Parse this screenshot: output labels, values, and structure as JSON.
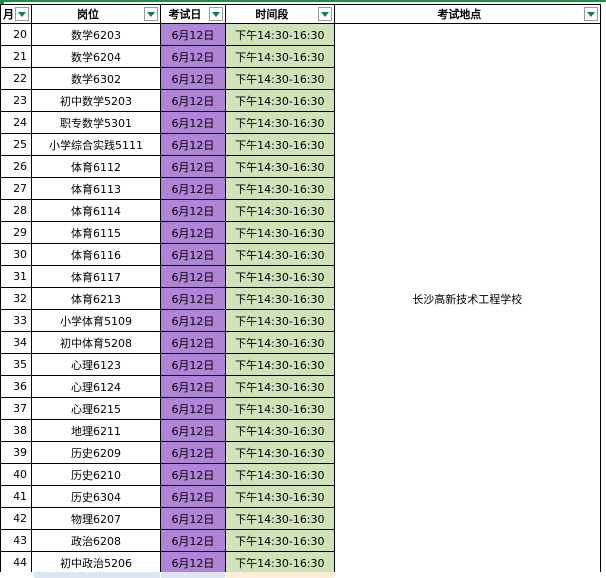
{
  "headers": {
    "no": "月",
    "position": "岗位",
    "date": "考试日",
    "time": "时间段",
    "location": "考试地点"
  },
  "location_merged": "长沙高新技术工程学校",
  "colors": {
    "date_fill": "#b084d6",
    "time_fill": "#cfe2b8",
    "dropdown_arrow": "#1a7f47",
    "selection_border": "#1f8c4a"
  },
  "rows": [
    {
      "no": "20",
      "position": "数学6203",
      "date": "6月12日",
      "time": "下午14:30-16:30"
    },
    {
      "no": "21",
      "position": "数学6204",
      "date": "6月12日",
      "time": "下午14:30-16:30"
    },
    {
      "no": "22",
      "position": "数学6302",
      "date": "6月12日",
      "time": "下午14:30-16:30"
    },
    {
      "no": "23",
      "position": "初中数学5203",
      "date": "6月12日",
      "time": "下午14:30-16:30"
    },
    {
      "no": "24",
      "position": "职专数学5301",
      "date": "6月12日",
      "time": "下午14:30-16:30"
    },
    {
      "no": "25",
      "position": "小学综合实践5111",
      "date": "6月12日",
      "time": "下午14:30-16:30"
    },
    {
      "no": "26",
      "position": "体育6112",
      "date": "6月12日",
      "time": "下午14:30-16:30"
    },
    {
      "no": "27",
      "position": "体育6113",
      "date": "6月12日",
      "time": "下午14:30-16:30"
    },
    {
      "no": "28",
      "position": "体育6114",
      "date": "6月12日",
      "time": "下午14:30-16:30"
    },
    {
      "no": "29",
      "position": "体育6115",
      "date": "6月12日",
      "time": "下午14:30-16:30"
    },
    {
      "no": "30",
      "position": "体育6116",
      "date": "6月12日",
      "time": "下午14:30-16:30"
    },
    {
      "no": "31",
      "position": "体育6117",
      "date": "6月12日",
      "time": "下午14:30-16:30"
    },
    {
      "no": "32",
      "position": "体育6213",
      "date": "6月12日",
      "time": "下午14:30-16:30"
    },
    {
      "no": "33",
      "position": "小学体育5109",
      "date": "6月12日",
      "time": "下午14:30-16:30"
    },
    {
      "no": "34",
      "position": "初中体育5208",
      "date": "6月12日",
      "time": "下午14:30-16:30"
    },
    {
      "no": "35",
      "position": "心理6123",
      "date": "6月12日",
      "time": "下午14:30-16:30"
    },
    {
      "no": "36",
      "position": "心理6124",
      "date": "6月12日",
      "time": "下午14:30-16:30"
    },
    {
      "no": "37",
      "position": "心理6215",
      "date": "6月12日",
      "time": "下午14:30-16:30"
    },
    {
      "no": "38",
      "position": "地理6211",
      "date": "6月12日",
      "time": "下午14:30-16:30"
    },
    {
      "no": "39",
      "position": "历史6209",
      "date": "6月12日",
      "time": "下午14:30-16:30"
    },
    {
      "no": "40",
      "position": "历史6210",
      "date": "6月12日",
      "time": "下午14:30-16:30"
    },
    {
      "no": "41",
      "position": "历史6304",
      "date": "6月12日",
      "time": "下午14:30-16:30"
    },
    {
      "no": "42",
      "position": "物理6207",
      "date": "6月12日",
      "time": "下午14:30-16:30"
    },
    {
      "no": "43",
      "position": "政治6208",
      "date": "6月12日",
      "time": "下午14:30-16:30"
    },
    {
      "no": "44",
      "position": "初中政治5206",
      "date": "6月12日",
      "time": "下午14:30-16:30"
    }
  ]
}
